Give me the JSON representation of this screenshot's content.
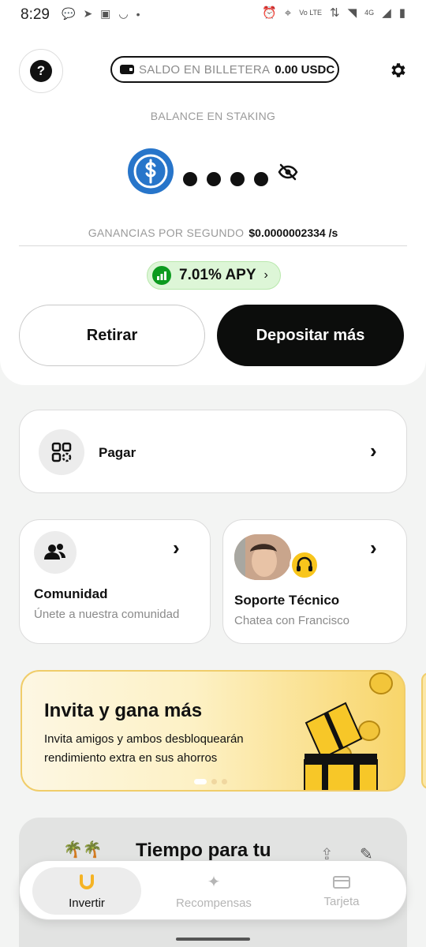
{
  "status_bar": {
    "time": "8:29",
    "network_label": "Vo LTE",
    "network_gen": "4G"
  },
  "header": {
    "help_label": "?",
    "wallet_label": "SALDO EN BILLETERA",
    "wallet_value": "0.00 USDC"
  },
  "staking": {
    "title": "BALANCE EN STAKING",
    "earnings_label": "GANANCIAS POR SEGUNDO",
    "earnings_value": "$0.0000002334",
    "earnings_unit": "/s",
    "apy": "7.01% APY"
  },
  "actions": {
    "withdraw": "Retirar",
    "deposit": "Depositar más"
  },
  "cards": {
    "pay": "Pagar",
    "community_title": "Comunidad",
    "community_sub": "Únete a nuestra comunidad",
    "support_title": "Soporte Técnico",
    "support_sub": "Chatea con Francisco"
  },
  "banner": {
    "title": "Invita y gana más",
    "text": "Invita amigos y ambos desbloquearán rendimiento extra en sus ahorros"
  },
  "next_card": {
    "title": "Tiempo para tu"
  },
  "nav": {
    "invest": "Invertir",
    "rewards": "Recompensas",
    "card": "Tarjeta"
  },
  "colors": {
    "primary": "#0c0d0c",
    "apy_bg": "#ddf6d7",
    "apy_icon": "#0c9b1f",
    "usdc_blue": "#2775ca",
    "banner_gold": "#f8d56a"
  }
}
